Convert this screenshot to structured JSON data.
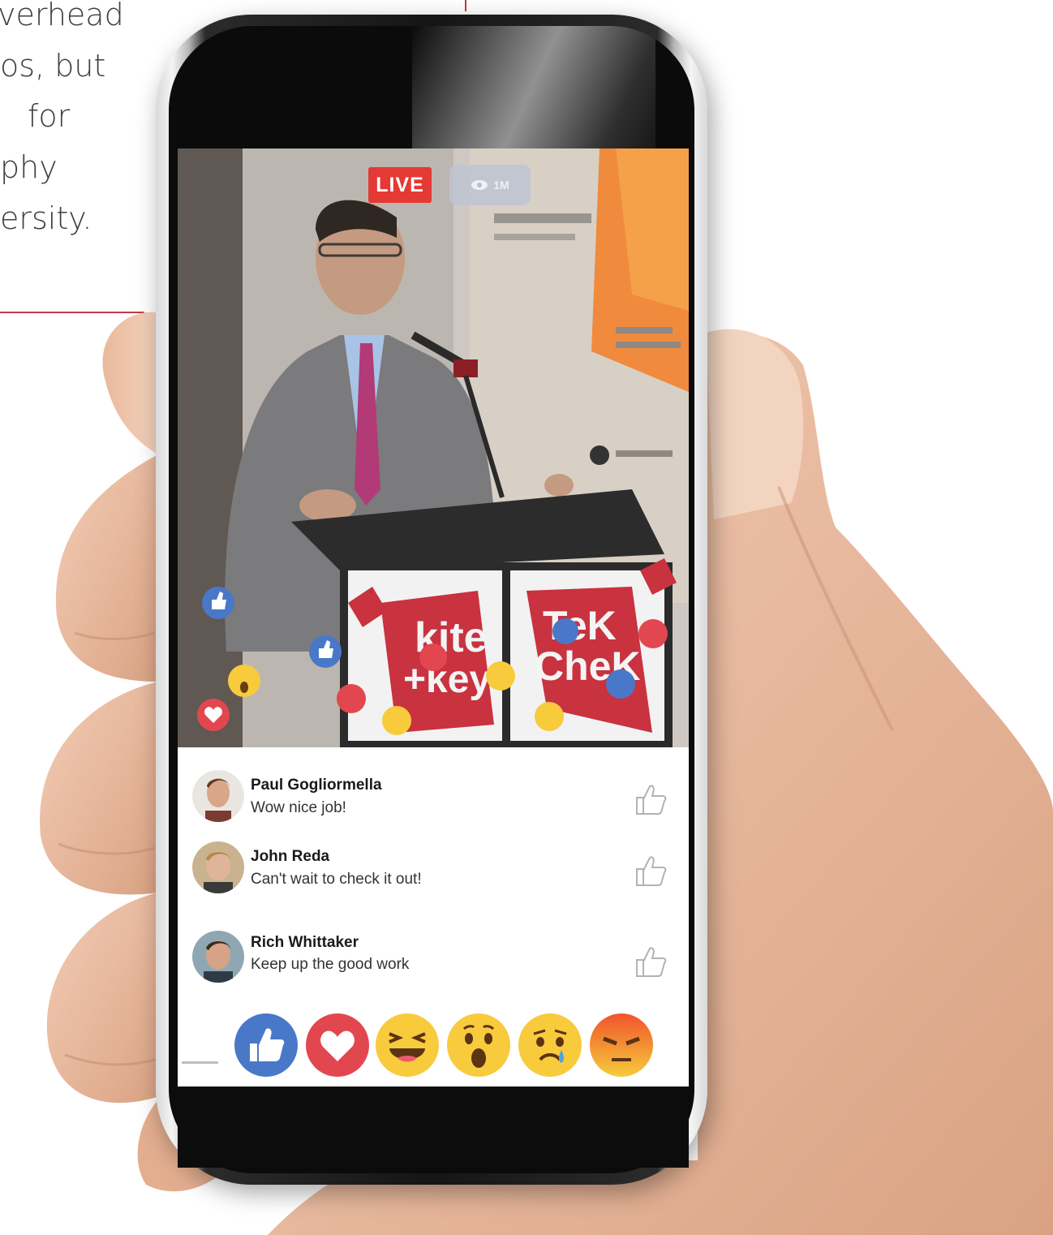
{
  "article": {
    "lines": [
      "verhead",
      "os, but",
      "for",
      "phy",
      "ersity."
    ]
  },
  "stream": {
    "live_label": "LIVE",
    "viewers_label": "1M"
  },
  "comments": [
    {
      "name": "Paul Gogliormella",
      "text": "Wow nice job!"
    },
    {
      "name": "John Reda",
      "text": "Can't wait to check it out!"
    },
    {
      "name": "Rich Whittaker",
      "text": "Keep up the good work"
    }
  ],
  "reactions": [
    "like-icon",
    "love-icon",
    "haha-icon",
    "wow-icon",
    "sad-icon",
    "angry-icon"
  ],
  "colors": {
    "live_red": "#e53935",
    "like_blue": "#4a78c8",
    "love_red": "#e2474f",
    "emoji_yellow": "#f7cb3c",
    "angry_orange": "#f06a2a",
    "accent_rule": "#c23b46"
  }
}
